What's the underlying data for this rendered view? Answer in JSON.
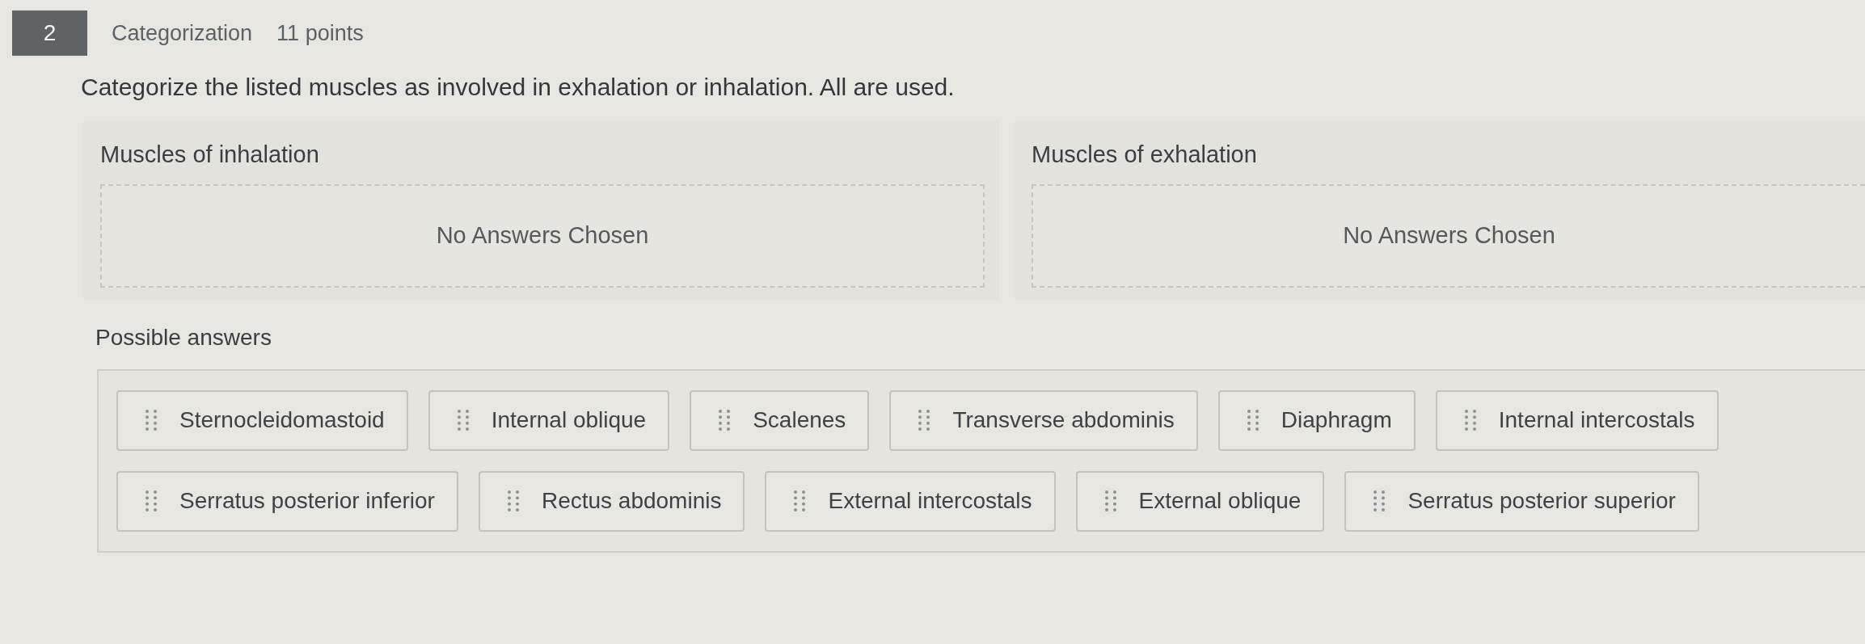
{
  "question": {
    "number": "2",
    "type": "Categorization",
    "points": "11 points",
    "prompt": "Categorize the listed muscles as involved in exhalation or inhalation. All are used."
  },
  "categories": [
    {
      "title": "Muscles of inhalation",
      "empty_text": "No Answers Chosen"
    },
    {
      "title": "Muscles of exhalation",
      "empty_text": "No Answers Chosen"
    }
  ],
  "possible_answers": {
    "title": "Possible answers",
    "items": [
      "Sternocleidomastoid",
      "Internal oblique",
      "Scalenes",
      "Transverse abdominis",
      "Diaphragm",
      "Internal intercostals",
      "Serratus posterior inferior",
      "Rectus abdominis",
      "External intercostals",
      "External oblique",
      "Serratus posterior superior"
    ]
  }
}
